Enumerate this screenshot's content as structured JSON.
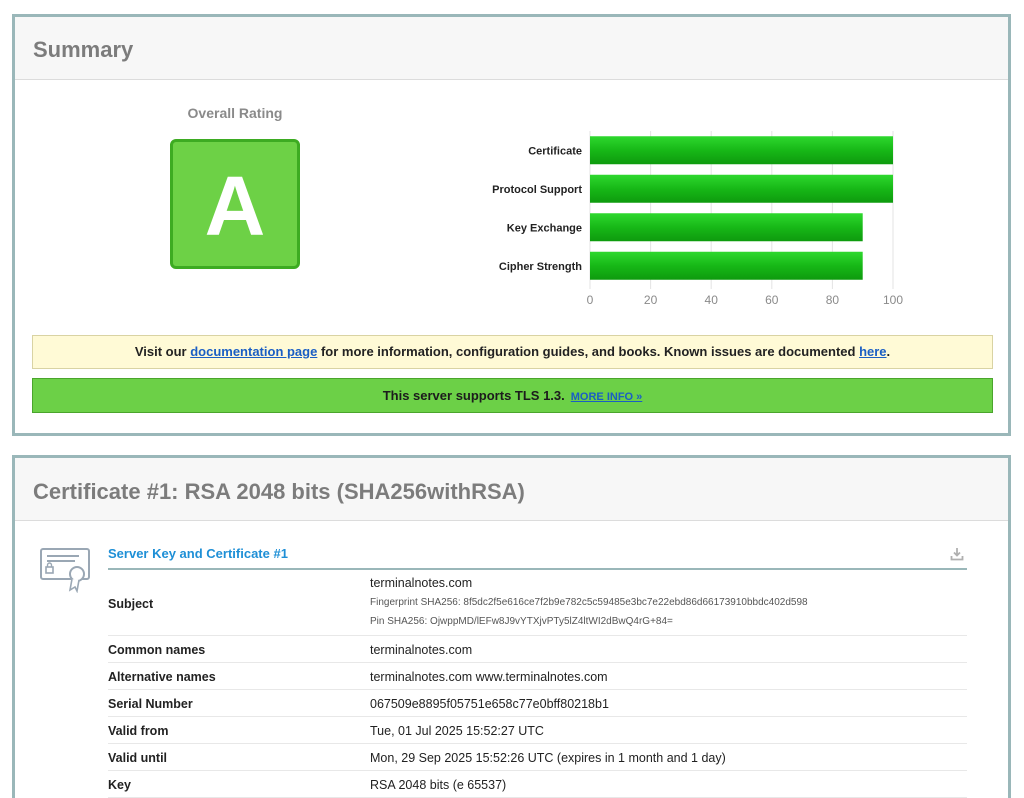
{
  "summary": {
    "title": "Summary",
    "rating_label": "Overall Rating",
    "grade": "A",
    "notice": {
      "prefix": "Visit our ",
      "link1": "documentation page",
      "middle": " for more information, configuration guides, and books. Known issues are documented ",
      "link2": "here",
      "suffix": "."
    },
    "tls_notice": {
      "text": "This server supports TLS 1.3.",
      "link": "MORE INFO »"
    }
  },
  "chart_data": {
    "type": "bar",
    "orientation": "horizontal",
    "categories": [
      "Certificate",
      "Protocol Support",
      "Key Exchange",
      "Cipher Strength"
    ],
    "values": [
      100,
      100,
      90,
      90
    ],
    "xlim": [
      0,
      100
    ],
    "xticks": [
      0,
      20,
      40,
      60,
      80,
      100
    ],
    "grid": true,
    "bar_color": "#17b817"
  },
  "certificate": {
    "title": "Certificate #1: RSA 2048 bits (SHA256withRSA)",
    "section_title": "Server Key and Certificate #1",
    "subject": {
      "label": "Subject",
      "value": "terminalnotes.com",
      "fingerprint": "Fingerprint SHA256: 8f5dc2f5e616ce7f2b9e782c5c59485e3bc7e22ebd86d66173910bbdc402d598",
      "pin": "Pin SHA256: OjwppMD/lEFw8J9vYTXjvPTy5lZ4ltWI2dBwQ4rG+84="
    },
    "rows": [
      {
        "label": "Common names",
        "value": "terminalnotes.com"
      },
      {
        "label": "Alternative names",
        "value": "terminalnotes.com www.terminalnotes.com"
      },
      {
        "label": "Serial Number",
        "value": "067509e8895f05751e658c77e0bff80218b1"
      },
      {
        "label": "Valid from",
        "value": "Tue, 01 Jul 2025 15:52:27 UTC"
      },
      {
        "label": "Valid until",
        "value": "Mon, 29 Sep 2025 15:52:26 UTC (expires in 1 month and 1 day)"
      },
      {
        "label": "Key",
        "value": "RSA 2048 bits (e 65537)"
      }
    ]
  },
  "icons": {
    "certificate": "certificate-icon",
    "download": "download-icon"
  }
}
